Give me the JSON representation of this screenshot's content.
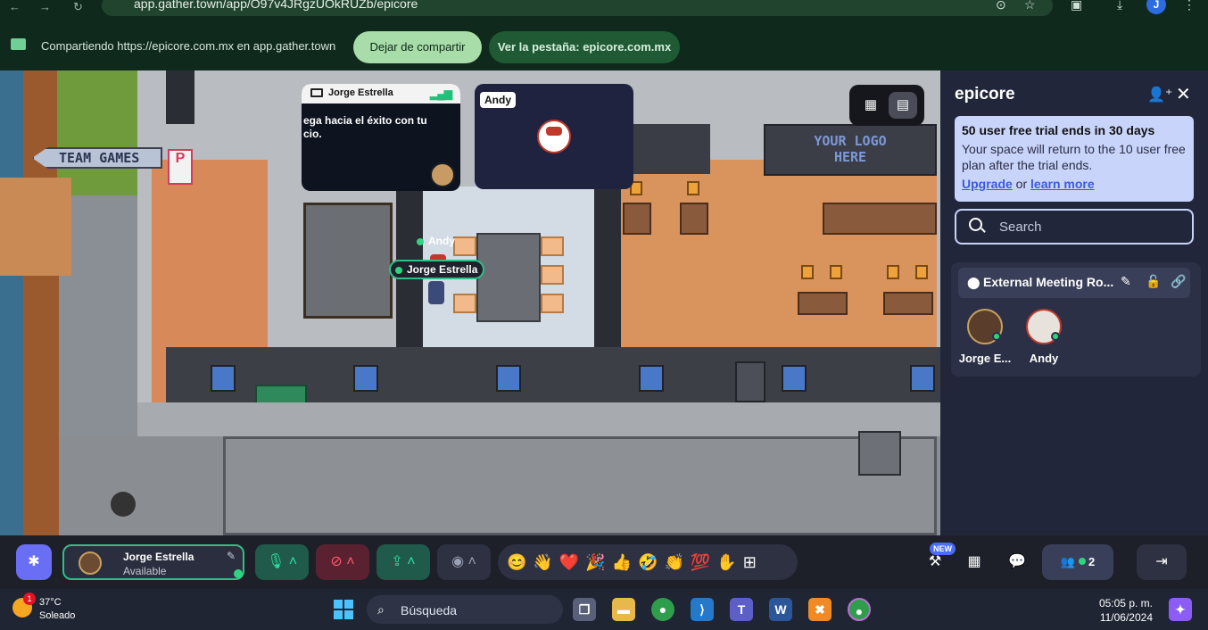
{
  "browser": {
    "url": "app.gather.town/app/O97v4JRgzUOkRUZb/epicore",
    "profile_initial": "J"
  },
  "share_bar": {
    "message": "Compartiendo https://epicore.com.mx en app.gather.town",
    "stop_label": "Dejar de compartir",
    "goto_tab_label": "Ver la pestaña: epicore.com.mx"
  },
  "map": {
    "sign_team": "TEAM GAMES",
    "sign_logo_line1": "YOUR LOGO",
    "sign_logo_line2": "HERE",
    "parking_letter": "P",
    "nametag_andy": "Andy",
    "nametag_jorge": "Jorge Estrella",
    "tile_screen_name": "Jorge Estrella",
    "tile_screen_line1": "ega hacia el éxito con tu",
    "tile_screen_line2": "cio.",
    "tile_andy_name": "Andy"
  },
  "panel": {
    "title": "epicore",
    "trial_heading": "50 user free trial ends in 30 days",
    "trial_body": "Your space will return to the 10 user free plan after the trial ends.",
    "upgrade_link": "Upgrade",
    "or_text": " or ",
    "learn_link": "learn more",
    "search_placeholder": "Search",
    "room_name": "External Meeting Ro...",
    "members": [
      {
        "name": "Jorge E..."
      },
      {
        "name": "Andy"
      }
    ]
  },
  "toolbar": {
    "user_name": "Jorge Estrella",
    "user_status": "Available",
    "new_badge": "NEW",
    "people_count": "2",
    "emojis": "😊👋❤️🎉👍🤣👏💯"
  },
  "taskbar": {
    "weather_badge": "1",
    "temperature": "37°C",
    "condition": "Soleado",
    "search_label": "Búsqueda",
    "time": "05:05 p. m.",
    "date": "11/06/2024"
  }
}
